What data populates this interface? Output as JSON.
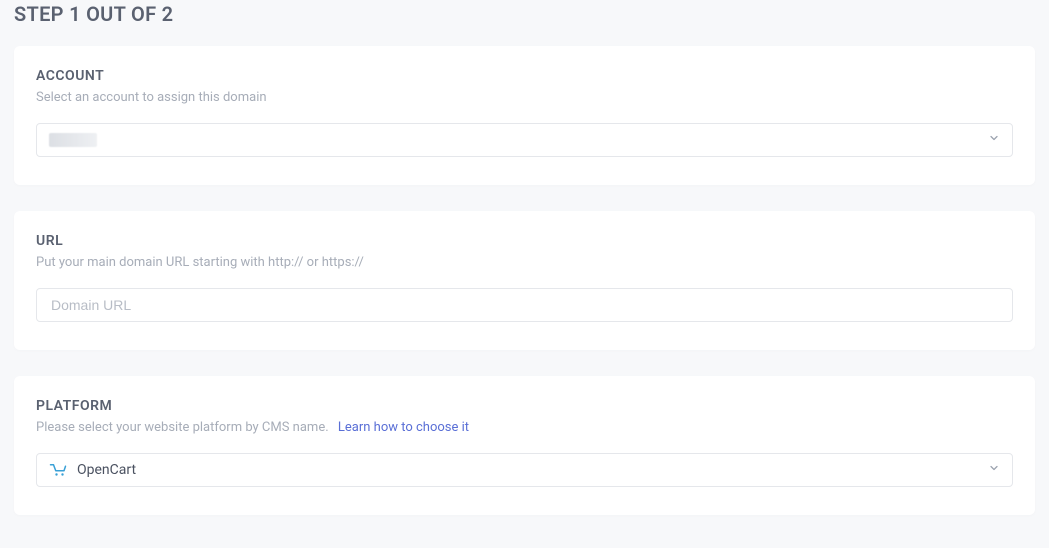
{
  "page": {
    "title": "STEP 1 OUT OF 2"
  },
  "account": {
    "title": "ACCOUNT",
    "subtitle": "Select an account to assign this domain",
    "selected": ""
  },
  "url": {
    "title": "URL",
    "subtitle": "Put your main domain URL starting with http:// or https://",
    "placeholder": "Domain URL",
    "value": ""
  },
  "platform": {
    "title": "PLATFORM",
    "subtitle": "Please select your website platform by CMS name.",
    "learn_link": "Learn how to choose it",
    "selected": "OpenCart"
  }
}
